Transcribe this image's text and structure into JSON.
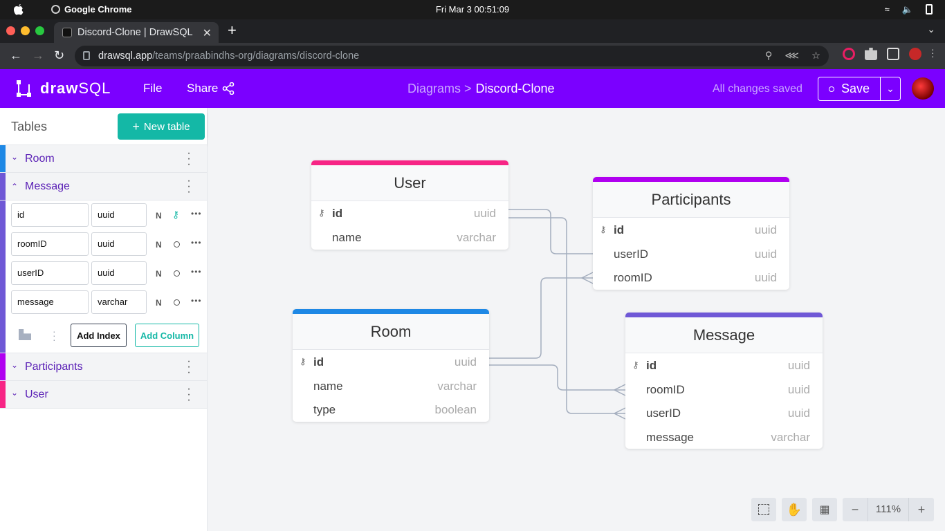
{
  "system": {
    "app_name": "Google Chrome",
    "clock": "Fri Mar 3  00:51:09"
  },
  "browser": {
    "tab_title": "Discord-Clone | DrawSQL",
    "url_host": "drawsql.app",
    "url_path": "/teams/praabindhs-org/diagrams/discord-clone"
  },
  "appbar": {
    "logo_bold": "draw",
    "logo_light": "SQL",
    "file_label": "File",
    "share_label": "Share",
    "breadcrumb_parent": "Diagrams >",
    "breadcrumb_current": "Discord-Clone",
    "status": "All changes saved",
    "save_label": "Save"
  },
  "sidebar": {
    "title": "Tables",
    "new_table_label": "New table",
    "tables": [
      {
        "name": "Room",
        "color": "#1e88e5",
        "expanded": false
      },
      {
        "name": "Message",
        "color": "#6f58d6",
        "expanded": true
      },
      {
        "name": "Participants",
        "color": "#b000f0",
        "expanded": false
      },
      {
        "name": "User",
        "color": "#f72585",
        "expanded": false
      }
    ],
    "columns": [
      {
        "name": "id",
        "type": "uuid",
        "nullable": "N",
        "primary": true
      },
      {
        "name": "roomID",
        "type": "uuid",
        "nullable": "N",
        "primary": false
      },
      {
        "name": "userID",
        "type": "uuid",
        "nullable": "N",
        "primary": false
      },
      {
        "name": "message",
        "type": "varchar",
        "nullable": "N",
        "primary": false
      }
    ],
    "add_index_label": "Add Index",
    "add_column_label": "Add Column"
  },
  "diagram": {
    "user": {
      "title": "User",
      "color": "#f72585",
      "rows": [
        {
          "name": "id",
          "type": "uuid"
        },
        {
          "name": "name",
          "type": "varchar"
        }
      ]
    },
    "participants": {
      "title": "Participants",
      "color": "#b000f0",
      "rows": [
        {
          "name": "id",
          "type": "uuid"
        },
        {
          "name": "userID",
          "type": "uuid"
        },
        {
          "name": "roomID",
          "type": "uuid"
        }
      ]
    },
    "room": {
      "title": "Room",
      "color": "#1e88e5",
      "rows": [
        {
          "name": "id",
          "type": "uuid"
        },
        {
          "name": "name",
          "type": "varchar"
        },
        {
          "name": "type",
          "type": "boolean"
        }
      ]
    },
    "message": {
      "title": "Message",
      "color": "#6f58d6",
      "rows": [
        {
          "name": "id",
          "type": "uuid"
        },
        {
          "name": "roomID",
          "type": "uuid"
        },
        {
          "name": "userID",
          "type": "uuid"
        },
        {
          "name": "message",
          "type": "varchar"
        }
      ]
    }
  },
  "zoom": {
    "level": "111%"
  }
}
